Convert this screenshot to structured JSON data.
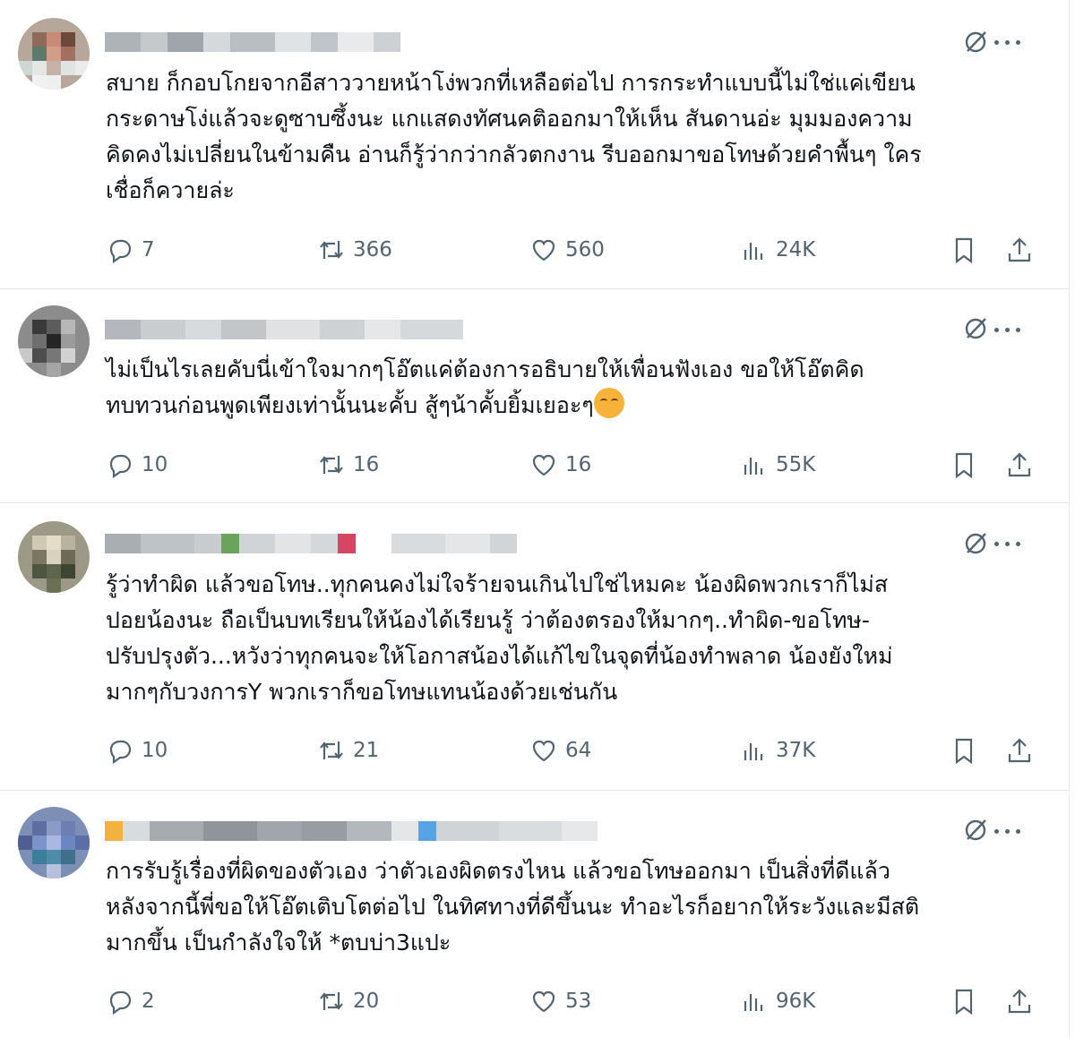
{
  "replies": [
    {
      "text": "สบาย ก็กอบโกยจากอีสาววายหน้าโง่พวกที่เหลือต่อไป การกระทำแบบนี้ไม่ใช่แค่เขียน\nกระดาษโง่แล้วจะดูซาบซึ้งนะ แกแสดงทัศนคติออกมาให้เห็น สันดานอ่ะ มุมมองความ\nคิดคงไม่เปลี่ยนในข้ามคืน อ่านก็รู้ว่ากว่ากลัวตกงาน รีบออกมาขอโทษด้วยคำพื้นๆ ใคร\nเชื่อก็ควายล่ะ",
      "replies": "7",
      "reposts": "366",
      "likes": "560",
      "views": "24K"
    },
    {
      "text": "ไม่เป็นไรเลยคับนี่เข้าใจมากๆโอ๊ตแค่ต้องการอธิบายให้เพื่อนฟังเอง ขอให้โอ๊ตคิด\nทบทวนก่อนพูดเพียงเท่านั้นนะคั้บ สู้ๆน้าคั้บยิ้มเยอะๆ",
      "replies": "10",
      "reposts": "16",
      "likes": "16",
      "views": "55K"
    },
    {
      "text": "รู้ว่าทำผิด แล้วขอโทษ..ทุกคนคงไม่ใจร้ายจนเกินไปใช่ไหมคะ น้องผิดพวกเราก็ไม่ส\nปอยน้องนะ ถือเป็นบทเรียนให้น้องได้เรียนรู้ ว่าต้องตรองให้มากๆ..ทำผิด-ขอโทษ-\nปรับปรุงตัว...หวังว่าทุกคนจะให้โอกาสน้องได้แก้ไขในจุดที่น้องทำพลาด น้องยังใหม่\nมากๆกับวงการY  พวกเราก็ขอโทษแทนน้องด้วยเช่นกัน",
      "replies": "10",
      "reposts": "21",
      "likes": "64",
      "views": "37K"
    },
    {
      "text": "การรับรู้เรื่องที่ผิดของตัวเอง ว่าตัวเองผิดตรงไหน แล้วขอโทษออกมา เป็นสิ่งที่ดีแล้ว\nหลังจากนี้พี่ขอให้โอ๊ตเติบโตต่อไป ในทิศทางที่ดีขึ้นนะ ทำอะไรก็อยากให้ระวังและมีสติ\nมากขึ้น เป็นกำลังใจให้ *ตบบ่า3แปะ",
      "replies": "2",
      "reposts": "20",
      "likes": "53",
      "views": "96K"
    }
  ],
  "icons": {
    "reply": "reply-icon",
    "repost": "repost-icon",
    "like": "heart-icon",
    "views": "views-icon",
    "bookmark": "bookmark-icon",
    "share": "share-icon",
    "grok": "grok-icon",
    "more": "more-icon",
    "emoji": "smiling-face-emoji"
  },
  "colors": {
    "text": "#0f1419",
    "muted": "#536471",
    "divider": "#e6e9ec"
  }
}
